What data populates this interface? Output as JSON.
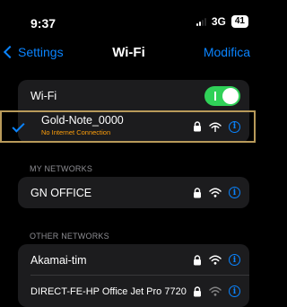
{
  "status_bar": {
    "time": "9:37",
    "network": "3G",
    "battery": "41"
  },
  "nav": {
    "back_label": "Settings",
    "title": "Wi-Fi",
    "action_label": "Modifica"
  },
  "wifi_toggle": {
    "label": "Wi-Fi",
    "enabled": true
  },
  "current_network": {
    "name": "Gold-Note_0000",
    "status": "No Internet Connection",
    "secured": true,
    "connected": true
  },
  "my_networks": {
    "header": "MY NETWORKS",
    "items": [
      {
        "name": "GN OFFICE",
        "secured": true
      }
    ]
  },
  "other_networks": {
    "header": "OTHER NETWORKS",
    "items": [
      {
        "name": "Akamai-tim",
        "secured": true
      },
      {
        "name": "DIRECT-FE-HP Office Jet Pro 7720",
        "secured": true
      }
    ]
  },
  "colors": {
    "accent": "#0a84ff",
    "toggle_on": "#30d158",
    "warning": "#ff9f0a",
    "highlight_border": "#b89a5a"
  }
}
